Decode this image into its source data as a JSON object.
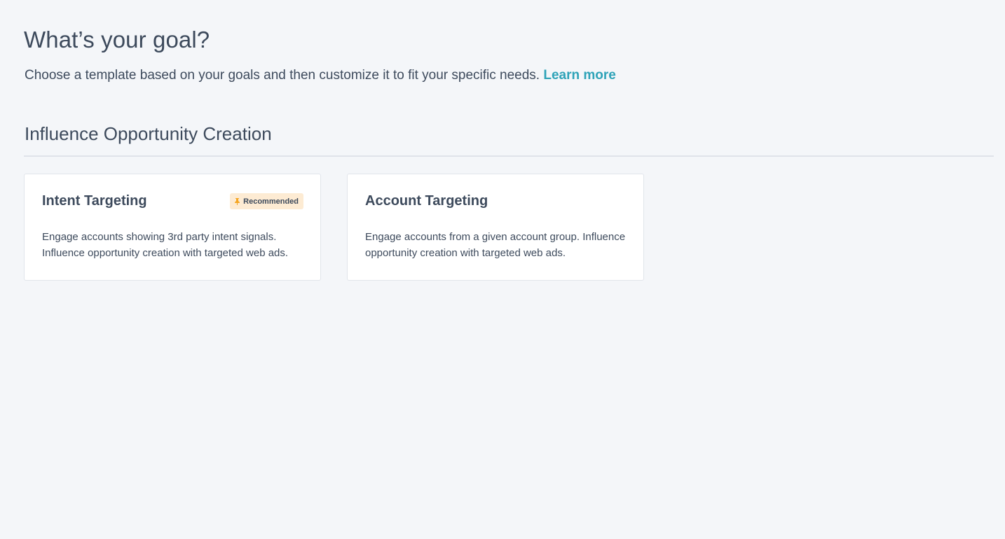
{
  "header": {
    "title": "What’s your goal?",
    "subtitle": "Choose a template based on your goals and then customize it to fit your specific needs.",
    "learn_more_label": "Learn more"
  },
  "section": {
    "title": "Influence Opportunity Creation"
  },
  "cards": [
    {
      "title": "Intent Targeting",
      "badge": "Recommended",
      "badge_icon": "pin-icon",
      "description": "Engage accounts showing 3rd party intent signals. Influence opportunity creation with targeted web ads."
    },
    {
      "title": "Account Targeting",
      "description": "Engage accounts from a given account group. Influence opportunity creation with targeted web ads."
    }
  ],
  "colors": {
    "background": "#f4f6f9",
    "text": "#3d4a5c",
    "link": "#2ea3b8",
    "badge_background": "#fdebd3",
    "badge_icon": "#f5a623",
    "card_border": "#e1e5eb",
    "divider": "#dfe3e9"
  }
}
